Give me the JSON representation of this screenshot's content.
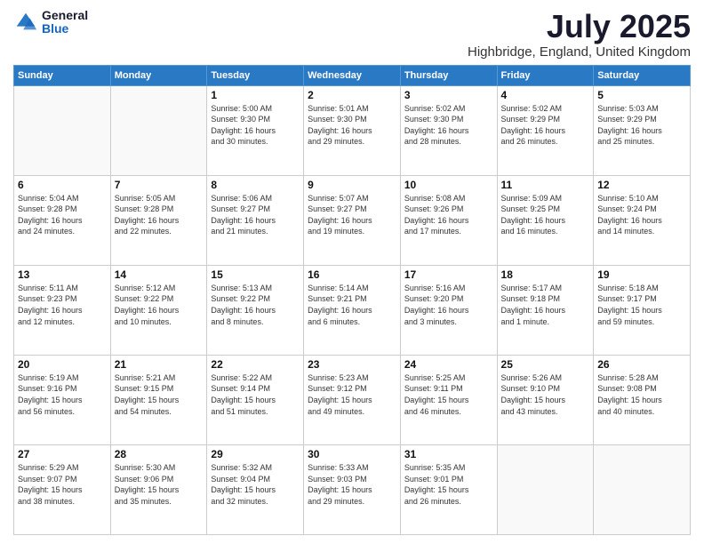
{
  "logo": {
    "general": "General",
    "blue": "Blue"
  },
  "header": {
    "month": "July 2025",
    "location": "Highbridge, England, United Kingdom"
  },
  "weekdays": [
    "Sunday",
    "Monday",
    "Tuesday",
    "Wednesday",
    "Thursday",
    "Friday",
    "Saturday"
  ],
  "weeks": [
    [
      {
        "day": "",
        "info": ""
      },
      {
        "day": "",
        "info": ""
      },
      {
        "day": "1",
        "info": "Sunrise: 5:00 AM\nSunset: 9:30 PM\nDaylight: 16 hours\nand 30 minutes."
      },
      {
        "day": "2",
        "info": "Sunrise: 5:01 AM\nSunset: 9:30 PM\nDaylight: 16 hours\nand 29 minutes."
      },
      {
        "day": "3",
        "info": "Sunrise: 5:02 AM\nSunset: 9:30 PM\nDaylight: 16 hours\nand 28 minutes."
      },
      {
        "day": "4",
        "info": "Sunrise: 5:02 AM\nSunset: 9:29 PM\nDaylight: 16 hours\nand 26 minutes."
      },
      {
        "day": "5",
        "info": "Sunrise: 5:03 AM\nSunset: 9:29 PM\nDaylight: 16 hours\nand 25 minutes."
      }
    ],
    [
      {
        "day": "6",
        "info": "Sunrise: 5:04 AM\nSunset: 9:28 PM\nDaylight: 16 hours\nand 24 minutes."
      },
      {
        "day": "7",
        "info": "Sunrise: 5:05 AM\nSunset: 9:28 PM\nDaylight: 16 hours\nand 22 minutes."
      },
      {
        "day": "8",
        "info": "Sunrise: 5:06 AM\nSunset: 9:27 PM\nDaylight: 16 hours\nand 21 minutes."
      },
      {
        "day": "9",
        "info": "Sunrise: 5:07 AM\nSunset: 9:27 PM\nDaylight: 16 hours\nand 19 minutes."
      },
      {
        "day": "10",
        "info": "Sunrise: 5:08 AM\nSunset: 9:26 PM\nDaylight: 16 hours\nand 17 minutes."
      },
      {
        "day": "11",
        "info": "Sunrise: 5:09 AM\nSunset: 9:25 PM\nDaylight: 16 hours\nand 16 minutes."
      },
      {
        "day": "12",
        "info": "Sunrise: 5:10 AM\nSunset: 9:24 PM\nDaylight: 16 hours\nand 14 minutes."
      }
    ],
    [
      {
        "day": "13",
        "info": "Sunrise: 5:11 AM\nSunset: 9:23 PM\nDaylight: 16 hours\nand 12 minutes."
      },
      {
        "day": "14",
        "info": "Sunrise: 5:12 AM\nSunset: 9:22 PM\nDaylight: 16 hours\nand 10 minutes."
      },
      {
        "day": "15",
        "info": "Sunrise: 5:13 AM\nSunset: 9:22 PM\nDaylight: 16 hours\nand 8 minutes."
      },
      {
        "day": "16",
        "info": "Sunrise: 5:14 AM\nSunset: 9:21 PM\nDaylight: 16 hours\nand 6 minutes."
      },
      {
        "day": "17",
        "info": "Sunrise: 5:16 AM\nSunset: 9:20 PM\nDaylight: 16 hours\nand 3 minutes."
      },
      {
        "day": "18",
        "info": "Sunrise: 5:17 AM\nSunset: 9:18 PM\nDaylight: 16 hours\nand 1 minute."
      },
      {
        "day": "19",
        "info": "Sunrise: 5:18 AM\nSunset: 9:17 PM\nDaylight: 15 hours\nand 59 minutes."
      }
    ],
    [
      {
        "day": "20",
        "info": "Sunrise: 5:19 AM\nSunset: 9:16 PM\nDaylight: 15 hours\nand 56 minutes."
      },
      {
        "day": "21",
        "info": "Sunrise: 5:21 AM\nSunset: 9:15 PM\nDaylight: 15 hours\nand 54 minutes."
      },
      {
        "day": "22",
        "info": "Sunrise: 5:22 AM\nSunset: 9:14 PM\nDaylight: 15 hours\nand 51 minutes."
      },
      {
        "day": "23",
        "info": "Sunrise: 5:23 AM\nSunset: 9:12 PM\nDaylight: 15 hours\nand 49 minutes."
      },
      {
        "day": "24",
        "info": "Sunrise: 5:25 AM\nSunset: 9:11 PM\nDaylight: 15 hours\nand 46 minutes."
      },
      {
        "day": "25",
        "info": "Sunrise: 5:26 AM\nSunset: 9:10 PM\nDaylight: 15 hours\nand 43 minutes."
      },
      {
        "day": "26",
        "info": "Sunrise: 5:28 AM\nSunset: 9:08 PM\nDaylight: 15 hours\nand 40 minutes."
      }
    ],
    [
      {
        "day": "27",
        "info": "Sunrise: 5:29 AM\nSunset: 9:07 PM\nDaylight: 15 hours\nand 38 minutes."
      },
      {
        "day": "28",
        "info": "Sunrise: 5:30 AM\nSunset: 9:06 PM\nDaylight: 15 hours\nand 35 minutes."
      },
      {
        "day": "29",
        "info": "Sunrise: 5:32 AM\nSunset: 9:04 PM\nDaylight: 15 hours\nand 32 minutes."
      },
      {
        "day": "30",
        "info": "Sunrise: 5:33 AM\nSunset: 9:03 PM\nDaylight: 15 hours\nand 29 minutes."
      },
      {
        "day": "31",
        "info": "Sunrise: 5:35 AM\nSunset: 9:01 PM\nDaylight: 15 hours\nand 26 minutes."
      },
      {
        "day": "",
        "info": ""
      },
      {
        "day": "",
        "info": ""
      }
    ]
  ]
}
